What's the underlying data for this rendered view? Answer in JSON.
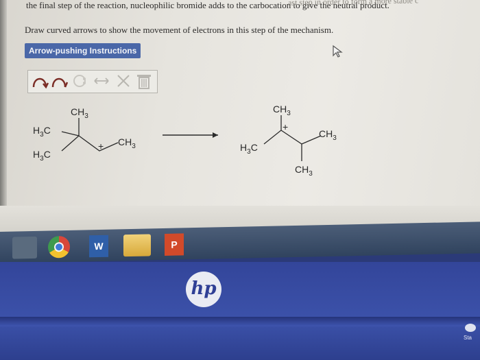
{
  "question": {
    "line1": "the final step of the reaction, nucleophilic bromide adds to the carbocation to give the neutral product.",
    "line1_faded": "ast step in order to form a more stable c",
    "line2": "Draw curved arrows to show the movement of electrons in this step of the mechanism."
  },
  "instructions_button": "Arrow-pushing Instructions",
  "toolbar": {
    "tools": [
      "curved-arrow-double-icon",
      "curved-arrow-single-icon",
      "electron-pair-icon",
      "resonance-arrow-icon",
      "delete-x-icon",
      "trash-icon"
    ]
  },
  "reactant": {
    "top_label": "CH3",
    "left_upper": "H3C",
    "left_lower": "H3C",
    "right_label": "CH3",
    "charge": "+"
  },
  "product": {
    "top_label": "CH3",
    "left_label": "H3C",
    "right_label": "CH3",
    "bottom_label": "CH3",
    "charge": "+"
  },
  "taskbar": {
    "apps": [
      "start",
      "chrome",
      "word",
      "folder",
      "powerpoint"
    ],
    "word_letter": "W",
    "ppt_letter": "P"
  },
  "laptop": {
    "brand": "hp",
    "start_label": "Sta"
  },
  "colors": {
    "accent": "#4a67a8",
    "bezel": "#3c52aa"
  }
}
